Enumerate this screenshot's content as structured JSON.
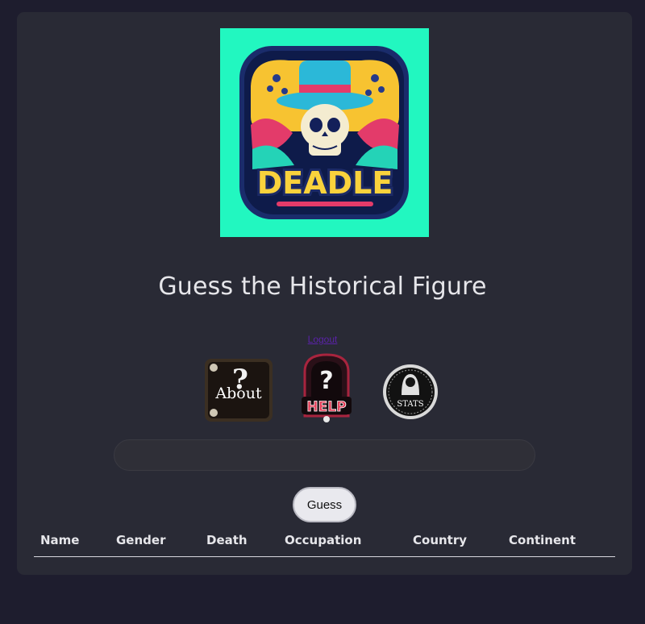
{
  "logo": {
    "brand_text": "DEADLE",
    "icon": "skull-gamepad-logo"
  },
  "header": {
    "title": "Guess the Historical Figure"
  },
  "nav": {
    "logout_label": "Logout",
    "about": {
      "label": "About",
      "icon": "about-question-icon"
    },
    "help": {
      "label": "HELP",
      "icon": "help-question-icon"
    },
    "stats": {
      "label": "STATS",
      "icon": "reaper-stats-icon"
    }
  },
  "search": {
    "value": "",
    "placeholder": ""
  },
  "guess_button": {
    "label": "Guess"
  },
  "table": {
    "columns": [
      "Name",
      "Gender",
      "Death",
      "Occupation",
      "Country",
      "Continent"
    ],
    "rows": []
  },
  "colors": {
    "page_bg": "#1e1d2e",
    "card_bg": "#292a35",
    "logo_bg": "#22f7c0",
    "link": "#5a22a8"
  }
}
